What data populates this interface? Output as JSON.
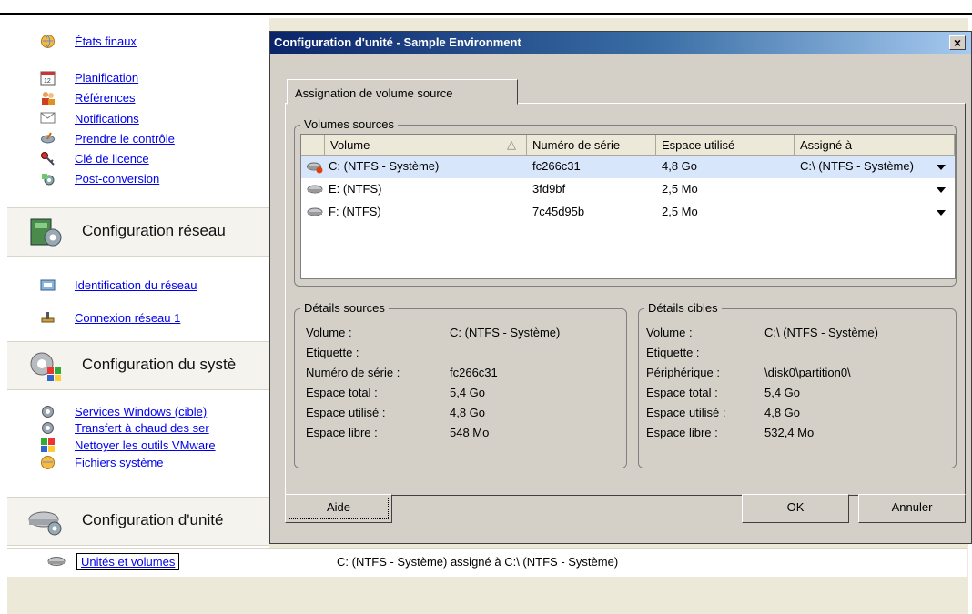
{
  "nav": {
    "items_top": [
      {
        "label": "États finaux",
        "icon": "globe-icon"
      },
      {
        "label": "Planification",
        "icon": "calendar-icon"
      },
      {
        "label": "Références",
        "icon": "users-icon"
      },
      {
        "label": "Notifications",
        "icon": "envelope-icon"
      },
      {
        "label": "Prendre le contrôle",
        "icon": "satellite-icon"
      },
      {
        "label": "Clé de licence",
        "icon": "key-icon"
      },
      {
        "label": "Post-conversion",
        "icon": "gear-script-icon"
      }
    ],
    "section_network": {
      "title": "Configuration réseau"
    },
    "items_network": [
      {
        "label": "Identification du réseau",
        "icon": "network-card-icon"
      },
      {
        "label": "Connexion réseau 1",
        "icon": "network-plug-icon"
      }
    ],
    "section_system": {
      "title": "Configuration du systè"
    },
    "items_system": [
      {
        "label": "Services Windows (cible)",
        "icon": "gear-icon"
      },
      {
        "label": "Transfert à chaud des ser",
        "icon": "gear-icon"
      },
      {
        "label": "Nettoyer les outils VMware",
        "icon": "blocks-icon"
      },
      {
        "label": "Fichiers système",
        "icon": "globe-icon"
      }
    ],
    "section_drive": {
      "title": "Configuration d'unité"
    }
  },
  "status": {
    "item_label": "Unités et volumes",
    "text": "C: (NTFS - Système) assigné à C:\\ (NTFS - Système)"
  },
  "dialog": {
    "title": "Configuration d'unité - Sample Environment",
    "close": "×",
    "tab": "Assignation de volume source",
    "volumes_group": "Volumes sources",
    "columns": [
      "Volume",
      "Numéro de série",
      "Espace utilisé",
      "Assigné à"
    ],
    "sort_indicator": "△",
    "rows": [
      {
        "volume": "C: (NTFS - Système)",
        "serial": "fc266c31",
        "used": "4,8 Go",
        "assigned": "C:\\ (NTFS - Système)",
        "selected": true
      },
      {
        "volume": "E: (NTFS)",
        "serial": "3fd9bf",
        "used": "2,5 Mo",
        "assigned": "",
        "selected": false
      },
      {
        "volume": "F: (NTFS)",
        "serial": "7c45d95b",
        "used": "2,5 Mo",
        "assigned": "",
        "selected": false
      }
    ],
    "source_details": {
      "title": "Détails sources",
      "pairs": [
        {
          "k": "Volume :",
          "v": "C: (NTFS - Système)"
        },
        {
          "k": "Etiquette :",
          "v": ""
        },
        {
          "k": "Numéro de série :",
          "v": "fc266c31"
        },
        {
          "k": "Espace total :",
          "v": "5,4 Go"
        },
        {
          "k": "Espace utilisé :",
          "v": "4,8 Go"
        },
        {
          "k": "Espace libre :",
          "v": "548 Mo"
        }
      ]
    },
    "target_details": {
      "title": "Détails cibles",
      "pairs": [
        {
          "k": "Volume :",
          "v": "C:\\ (NTFS - Système)"
        },
        {
          "k": "Etiquette :",
          "v": ""
        },
        {
          "k": "Périphérique :",
          "v": "\\disk0\\partition0\\"
        },
        {
          "k": "Espace total :",
          "v": "5,4 Go"
        },
        {
          "k": "Espace utilisé :",
          "v": "4,8 Go"
        },
        {
          "k": "Espace libre :",
          "v": "532,4 Mo"
        }
      ]
    },
    "buttons": {
      "help": "Aide",
      "ok": "OK",
      "cancel": "Annuler"
    }
  },
  "colors": {
    "title_start": "#0a246a",
    "title_end": "#a6caf0",
    "selected_row": "#d7e6fb",
    "link": "#0000ee",
    "dialog_bg": "#d4d0c8"
  }
}
